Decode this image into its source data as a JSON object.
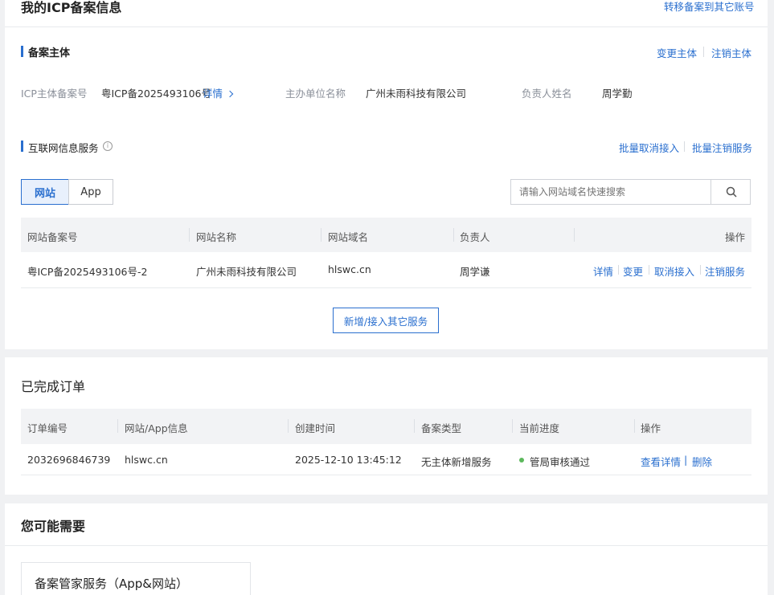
{
  "header": {
    "title": "我的ICP备案信息",
    "transfer_link": "转移备案到其它账号"
  },
  "subject": {
    "title": "备案主体",
    "change_link": "变更主体",
    "cancel_link": "注销主体",
    "fields": {
      "icp_label": "ICP主体备案号",
      "icp_value": "粤ICP备2025493106号",
      "detail_link": "详情",
      "org_label": "主办单位名称",
      "org_value": "广州未雨科技有限公司",
      "person_label": "负责人姓名",
      "person_value": "周学勤"
    }
  },
  "service": {
    "title": "互联网信息服务",
    "batch_cancel_access": "批量取消接入",
    "batch_cancel_service": "批量注销服务",
    "tabs": [
      "网站",
      "App"
    ],
    "search_placeholder": "请输入网站域名快速搜索",
    "columns": [
      "网站备案号",
      "网站名称",
      "网站域名",
      "负责人",
      "操作"
    ],
    "rows": [
      {
        "record_no": "粤ICP备2025493106号-2",
        "site_name": "广州未雨科技有限公司",
        "domain": "hlswc.cn",
        "owner": "周学谦",
        "actions": [
          "详情",
          "变更",
          "取消接入",
          "注销服务"
        ]
      }
    ],
    "add_button": "新增/接入其它服务"
  },
  "orders": {
    "title": "已完成订单",
    "columns": [
      "订单编号",
      "网站/App信息",
      "创建时间",
      "备案类型",
      "当前进度",
      "操作"
    ],
    "rows": [
      {
        "order_no": "2032696846739",
        "info": "hlswc.cn",
        "created": "2025-12-10 13:45:12",
        "type": "无主体新增服务",
        "progress": "管局审核通过",
        "view": "查看详情",
        "sep": "|",
        "delete": "删除"
      }
    ],
    "status_color": "#5cb85c"
  },
  "needs": {
    "title": "您可能需要",
    "card_title": "备案管家服务（App&网站）"
  },
  "colors": {
    "accent": "#2a6fcf"
  }
}
